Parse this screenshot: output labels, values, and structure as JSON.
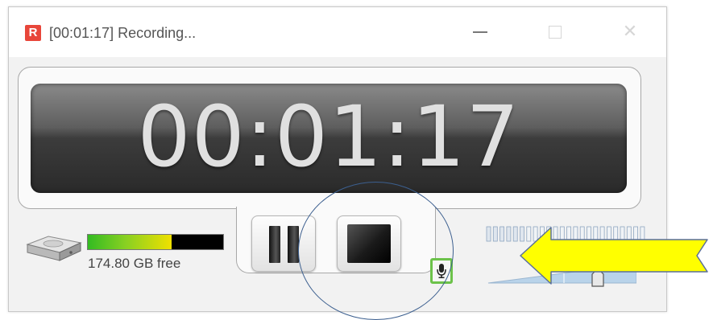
{
  "window": {
    "app_icon_letter": "R",
    "title": "[00:01:17] Recording...",
    "minimize_glyph": "—",
    "close_glyph": "✕"
  },
  "timer": {
    "display": "00:01:17"
  },
  "disk": {
    "free_label": "174.80 GB free",
    "used_fraction": 0.62
  },
  "controls": {
    "pause_icon": "pause-icon",
    "stop_icon": "stop-icon",
    "microphone_icon": "microphone-icon"
  },
  "audio": {
    "input_level_fraction": 0.25,
    "volume_fraction": 0.72
  },
  "annotations": {
    "circle_color": "#3c5f8f",
    "arrow_color": "#ffff00"
  },
  "colors": {
    "app_icon": "#e8463a",
    "mic_border": "#6cc24a",
    "timer_text": "#e0e0e0"
  }
}
